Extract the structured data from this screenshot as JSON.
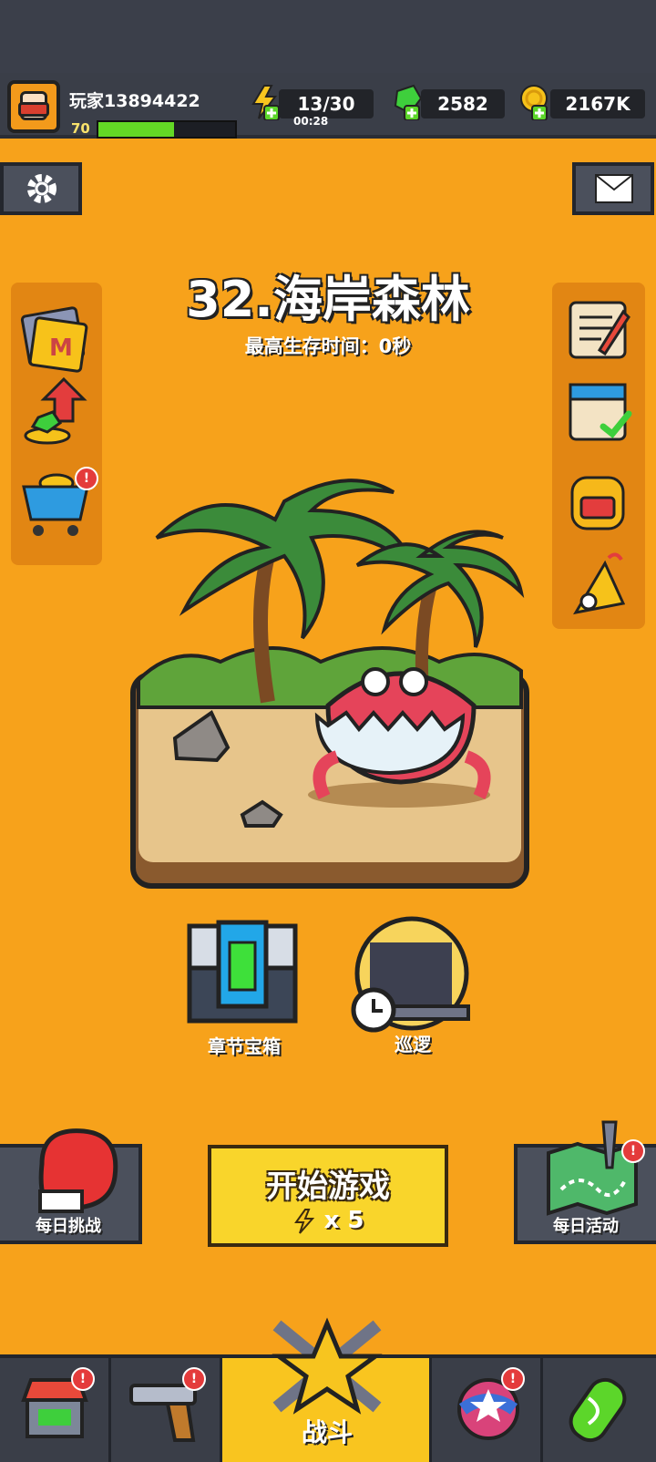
{
  "player": {
    "name": "玩家13894422",
    "level": "70",
    "xp_fraction": 0.55
  },
  "resources": {
    "energy": {
      "value": "13/30",
      "timer": "00:28",
      "icon": "lightning-plus-icon"
    },
    "gems": {
      "value": "2582",
      "icon": "gem-plus-icon"
    },
    "coins": {
      "value": "2167K",
      "icon": "coin-plus-icon"
    }
  },
  "stage": {
    "title": "32.海岸森林",
    "subtitle": "最高生存时间：0秒"
  },
  "left_menu": [
    "m-card-icon",
    "gems-up-icon",
    "shopping-cart-icon"
  ],
  "right_menu": [
    "scroll-quill-icon",
    "calendar-check-icon",
    "backpack-icon",
    "party-popper-icon"
  ],
  "features": {
    "chest_label": "章节宝箱",
    "patrol_label": "巡逻"
  },
  "actions": {
    "daily_challenge": "每日挑战",
    "start_game": "开始游戏",
    "start_cost": "x 5",
    "daily_event": "每日活动"
  },
  "nav": {
    "active_label": "战斗"
  },
  "colors": {
    "background": "#f7a21b",
    "accent": "#f9d52b",
    "xp": "#63d825",
    "badge": "#e43b3b"
  }
}
